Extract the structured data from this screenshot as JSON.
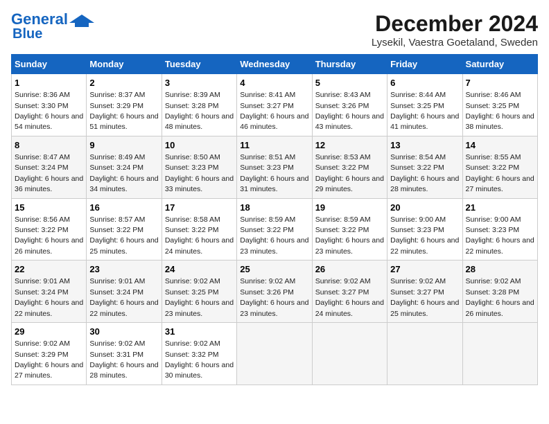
{
  "header": {
    "logo_line1": "General",
    "logo_line2": "Blue",
    "title": "December 2024",
    "subtitle": "Lysekil, Vaestra Goetaland, Sweden"
  },
  "days_of_week": [
    "Sunday",
    "Monday",
    "Tuesday",
    "Wednesday",
    "Thursday",
    "Friday",
    "Saturday"
  ],
  "weeks": [
    [
      {
        "day": 1,
        "info": "Sunrise: 8:36 AM\nSunset: 3:30 PM\nDaylight: 6 hours and 54 minutes."
      },
      {
        "day": 2,
        "info": "Sunrise: 8:37 AM\nSunset: 3:29 PM\nDaylight: 6 hours and 51 minutes."
      },
      {
        "day": 3,
        "info": "Sunrise: 8:39 AM\nSunset: 3:28 PM\nDaylight: 6 hours and 48 minutes."
      },
      {
        "day": 4,
        "info": "Sunrise: 8:41 AM\nSunset: 3:27 PM\nDaylight: 6 hours and 46 minutes."
      },
      {
        "day": 5,
        "info": "Sunrise: 8:43 AM\nSunset: 3:26 PM\nDaylight: 6 hours and 43 minutes."
      },
      {
        "day": 6,
        "info": "Sunrise: 8:44 AM\nSunset: 3:25 PM\nDaylight: 6 hours and 41 minutes."
      },
      {
        "day": 7,
        "info": "Sunrise: 8:46 AM\nSunset: 3:25 PM\nDaylight: 6 hours and 38 minutes."
      }
    ],
    [
      {
        "day": 8,
        "info": "Sunrise: 8:47 AM\nSunset: 3:24 PM\nDaylight: 6 hours and 36 minutes."
      },
      {
        "day": 9,
        "info": "Sunrise: 8:49 AM\nSunset: 3:24 PM\nDaylight: 6 hours and 34 minutes."
      },
      {
        "day": 10,
        "info": "Sunrise: 8:50 AM\nSunset: 3:23 PM\nDaylight: 6 hours and 33 minutes."
      },
      {
        "day": 11,
        "info": "Sunrise: 8:51 AM\nSunset: 3:23 PM\nDaylight: 6 hours and 31 minutes."
      },
      {
        "day": 12,
        "info": "Sunrise: 8:53 AM\nSunset: 3:22 PM\nDaylight: 6 hours and 29 minutes."
      },
      {
        "day": 13,
        "info": "Sunrise: 8:54 AM\nSunset: 3:22 PM\nDaylight: 6 hours and 28 minutes."
      },
      {
        "day": 14,
        "info": "Sunrise: 8:55 AM\nSunset: 3:22 PM\nDaylight: 6 hours and 27 minutes."
      }
    ],
    [
      {
        "day": 15,
        "info": "Sunrise: 8:56 AM\nSunset: 3:22 PM\nDaylight: 6 hours and 26 minutes."
      },
      {
        "day": 16,
        "info": "Sunrise: 8:57 AM\nSunset: 3:22 PM\nDaylight: 6 hours and 25 minutes."
      },
      {
        "day": 17,
        "info": "Sunrise: 8:58 AM\nSunset: 3:22 PM\nDaylight: 6 hours and 24 minutes."
      },
      {
        "day": 18,
        "info": "Sunrise: 8:59 AM\nSunset: 3:22 PM\nDaylight: 6 hours and 23 minutes."
      },
      {
        "day": 19,
        "info": "Sunrise: 8:59 AM\nSunset: 3:22 PM\nDaylight: 6 hours and 23 minutes."
      },
      {
        "day": 20,
        "info": "Sunrise: 9:00 AM\nSunset: 3:23 PM\nDaylight: 6 hours and 22 minutes."
      },
      {
        "day": 21,
        "info": "Sunrise: 9:00 AM\nSunset: 3:23 PM\nDaylight: 6 hours and 22 minutes."
      }
    ],
    [
      {
        "day": 22,
        "info": "Sunrise: 9:01 AM\nSunset: 3:24 PM\nDaylight: 6 hours and 22 minutes."
      },
      {
        "day": 23,
        "info": "Sunrise: 9:01 AM\nSunset: 3:24 PM\nDaylight: 6 hours and 22 minutes."
      },
      {
        "day": 24,
        "info": "Sunrise: 9:02 AM\nSunset: 3:25 PM\nDaylight: 6 hours and 23 minutes."
      },
      {
        "day": 25,
        "info": "Sunrise: 9:02 AM\nSunset: 3:26 PM\nDaylight: 6 hours and 23 minutes."
      },
      {
        "day": 26,
        "info": "Sunrise: 9:02 AM\nSunset: 3:27 PM\nDaylight: 6 hours and 24 minutes."
      },
      {
        "day": 27,
        "info": "Sunrise: 9:02 AM\nSunset: 3:27 PM\nDaylight: 6 hours and 25 minutes."
      },
      {
        "day": 28,
        "info": "Sunrise: 9:02 AM\nSunset: 3:28 PM\nDaylight: 6 hours and 26 minutes."
      }
    ],
    [
      {
        "day": 29,
        "info": "Sunrise: 9:02 AM\nSunset: 3:29 PM\nDaylight: 6 hours and 27 minutes."
      },
      {
        "day": 30,
        "info": "Sunrise: 9:02 AM\nSunset: 3:31 PM\nDaylight: 6 hours and 28 minutes."
      },
      {
        "day": 31,
        "info": "Sunrise: 9:02 AM\nSunset: 3:32 PM\nDaylight: 6 hours and 30 minutes."
      },
      null,
      null,
      null,
      null
    ]
  ]
}
